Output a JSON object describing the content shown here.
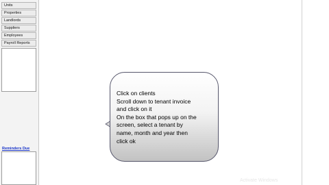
{
  "sidebar": {
    "items": [
      {
        "label": "Units"
      },
      {
        "label": "Properties"
      },
      {
        "label": "Landlords"
      },
      {
        "label": "Suppliers"
      },
      {
        "label": "Employees"
      },
      {
        "label": "Payroll Reports"
      }
    ],
    "reminders_title": "Reminders Due"
  },
  "callout": {
    "text": "Click on clients\nScroll down to tenant invoice\nand click on it\nOn the box that pops up on the\nscreen, select a tenant by\nname, month and year then\nclick ok"
  },
  "watermark": {
    "text": "Activate Windows"
  }
}
